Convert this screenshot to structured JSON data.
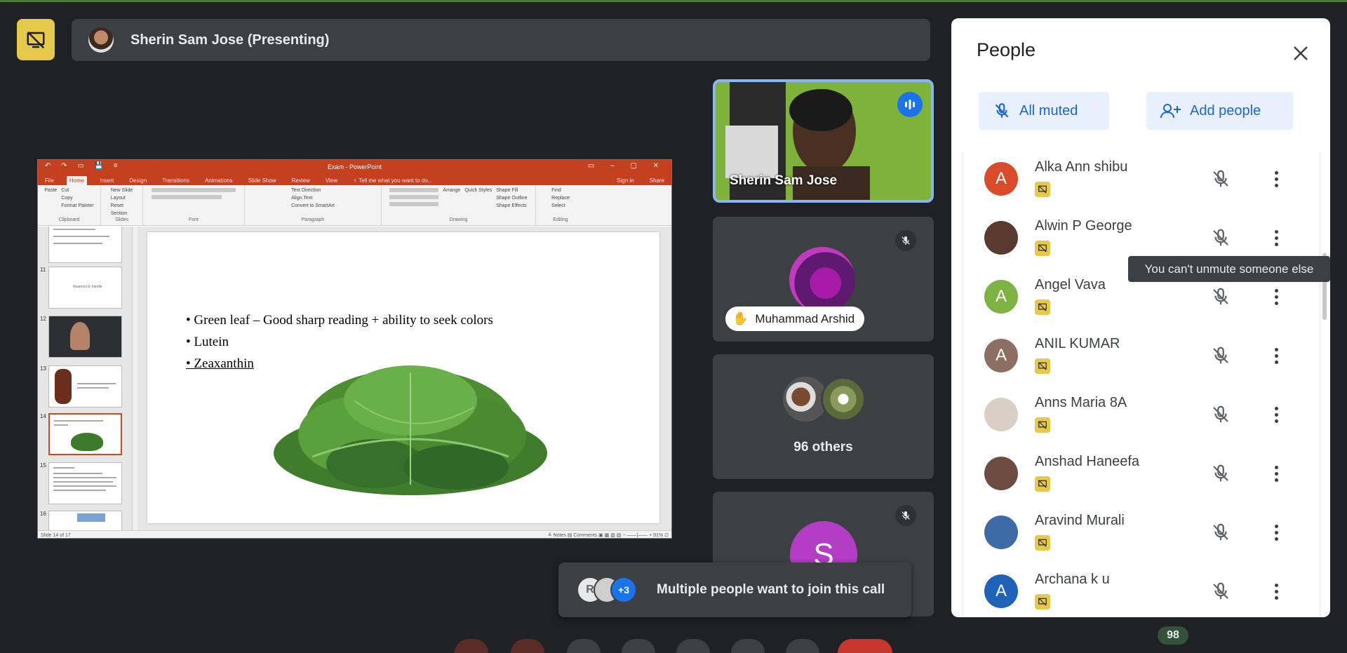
{
  "presenter": {
    "label": "Sherin Sam Jose (Presenting)"
  },
  "slide_app": {
    "window_title": "Exam - PowerPoint",
    "quick_access": "↶ ↷ ▭ 💾 ≡",
    "window_controls": "▭ – ▢ ✕",
    "tabs": [
      "File",
      "Home",
      "Insert",
      "Design",
      "Transitions",
      "Animations",
      "Slide Show",
      "Review",
      "View",
      "♀ Tell me what you want to do...",
      "Sign in",
      "Share"
    ],
    "active_tab": "Home",
    "ribbon_groups": [
      "Clipboard",
      "Slides",
      "Font",
      "Paragraph",
      "Drawing",
      "Editing"
    ],
    "clipboard_items": [
      "Cut",
      "Copy",
      "Format Painter"
    ],
    "paste_label": "Paste",
    "slides_items": [
      "New Slide",
      "Layout",
      "Reset",
      "Section"
    ],
    "editing_items": [
      "Find",
      "Replace",
      "Select"
    ],
    "drawing_items": [
      "Arrange",
      "Quick Styles",
      "Shape Fill",
      "Shape Outline",
      "Shape Effects"
    ],
    "paragraph_items": [
      "Text Direction",
      "Align Text",
      "Convert to SmartArt"
    ],
    "slide_numbers": [
      "11",
      "12",
      "13",
      "14",
      "15",
      "16"
    ],
    "thumb_11_text": "Nuances to handle",
    "current_slide_bullets": [
      "• Green leaf – Good sharp reading + ability to seek colors",
      "• Lutein",
      "• Zeaxanthin"
    ],
    "status_left": "Slide 14 of 17",
    "status_right": "≜ Notes   ▤ Comments   ▣ ▦ ▧ ▨   − ——|—— +  91%  ⊡"
  },
  "tiles": {
    "main_video_name": "Sherin Sam Jose",
    "raised_hand_name": "Muhammad Arshid",
    "others_label": "96 others",
    "bottom_tile_initial": "S"
  },
  "toast": {
    "avatar_initial": "R",
    "more_count": "+3",
    "message": "Multiple people want to join this call"
  },
  "people_panel": {
    "title": "People",
    "all_muted_label": "All muted",
    "add_people_label": "Add people",
    "participants": [
      {
        "name": "Alka Ann shibu",
        "initial": "A",
        "color": "#d94b2b"
      },
      {
        "name": "Alwin P George",
        "initial": "",
        "color": "#5a3a2e"
      },
      {
        "name": "Angel Vava",
        "initial": "A",
        "color": "#7cb342"
      },
      {
        "name": "ANIL KUMAR",
        "initial": "A",
        "color": "#8d6e63"
      },
      {
        "name": "Anns Maria 8A",
        "initial": "",
        "color": "#d9cfc5"
      },
      {
        "name": "Anshad Haneefa",
        "initial": "",
        "color": "#6d4c41"
      },
      {
        "name": "Aravind Murali",
        "initial": "",
        "color": "#3f6aa8"
      },
      {
        "name": "Archana k u",
        "initial": "A",
        "color": "#1e63b8"
      }
    ],
    "tooltip": "You can't unmute someone else"
  },
  "participant_count": "98",
  "colors": {
    "background": "#202124",
    "panel": "#ffffff",
    "accent_blue": "#1a73e8",
    "present_yellow": "#e6c94a",
    "ppt_orange": "#c4401f"
  },
  "icons": [
    "stop-presenting-icon",
    "mic-off-icon",
    "speaking-icon",
    "raised-hand-icon",
    "close-icon",
    "person-add-icon",
    "more-vert-icon",
    "presentation-badge-icon"
  ]
}
